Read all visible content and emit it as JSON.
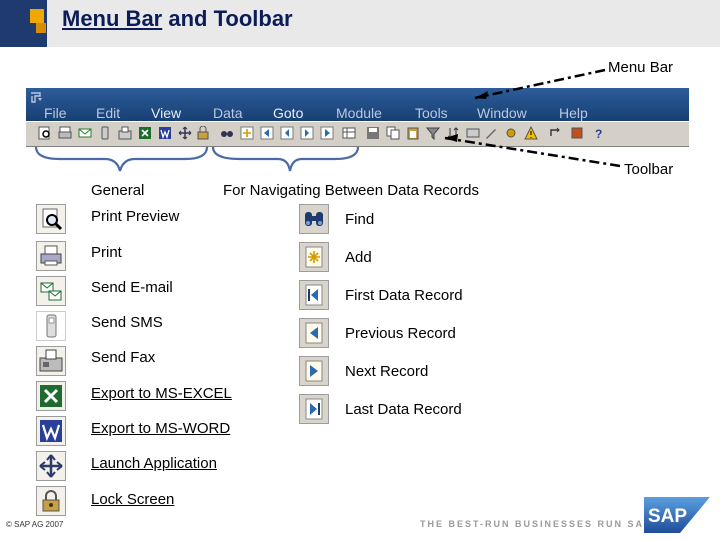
{
  "title": {
    "underlined": "Menu Bar",
    "rest": " and Toolbar"
  },
  "annotations": {
    "menu_bar": "Menu Bar",
    "toolbar": "Toolbar"
  },
  "menubar": {
    "items": [
      "File",
      "Edit",
      "View",
      "Data",
      "Goto",
      "Module",
      "Tools",
      "Window",
      "Help"
    ]
  },
  "sections": {
    "general": "General",
    "navigating": "For Navigating Between Data Records"
  },
  "general_items": [
    {
      "label": "Print Preview",
      "icon": "print-preview-icon"
    },
    {
      "label": "Print",
      "icon": "printer-icon"
    },
    {
      "label": "Send E-mail",
      "icon": "email-icon"
    },
    {
      "label": "Send SMS",
      "icon": "mobile-phone-icon"
    },
    {
      "label": "Send Fax",
      "icon": "fax-icon"
    },
    {
      "label": "Export to MS-EXCEL",
      "icon": "excel-icon"
    },
    {
      "label": "Export to MS-WORD",
      "icon": "word-icon"
    },
    {
      "label": "Launch Application",
      "icon": "launch-arrows-icon"
    },
    {
      "label": "Lock Screen",
      "icon": "lock-icon"
    }
  ],
  "navigation_items": [
    {
      "label": "Find",
      "icon": "binoculars-icon"
    },
    {
      "label": "Add",
      "icon": "add-record-icon"
    },
    {
      "label": "First Data Record",
      "icon": "first-record-icon"
    },
    {
      "label": "Previous Record",
      "icon": "previous-record-icon"
    },
    {
      "label": "Next Record",
      "icon": "next-record-icon"
    },
    {
      "label": "Last Data Record",
      "icon": "last-record-icon"
    }
  ],
  "footer": {
    "copyright": "SAP AG 2007",
    "tagline": "THE BEST-RUN BUSINESSES RUN SAP",
    "logo": "SAP"
  },
  "colors": {
    "title": "#0b1c58",
    "menubar": "#1f4c86",
    "toolbar": "#d4d0c8",
    "accent": "#f0a800"
  }
}
